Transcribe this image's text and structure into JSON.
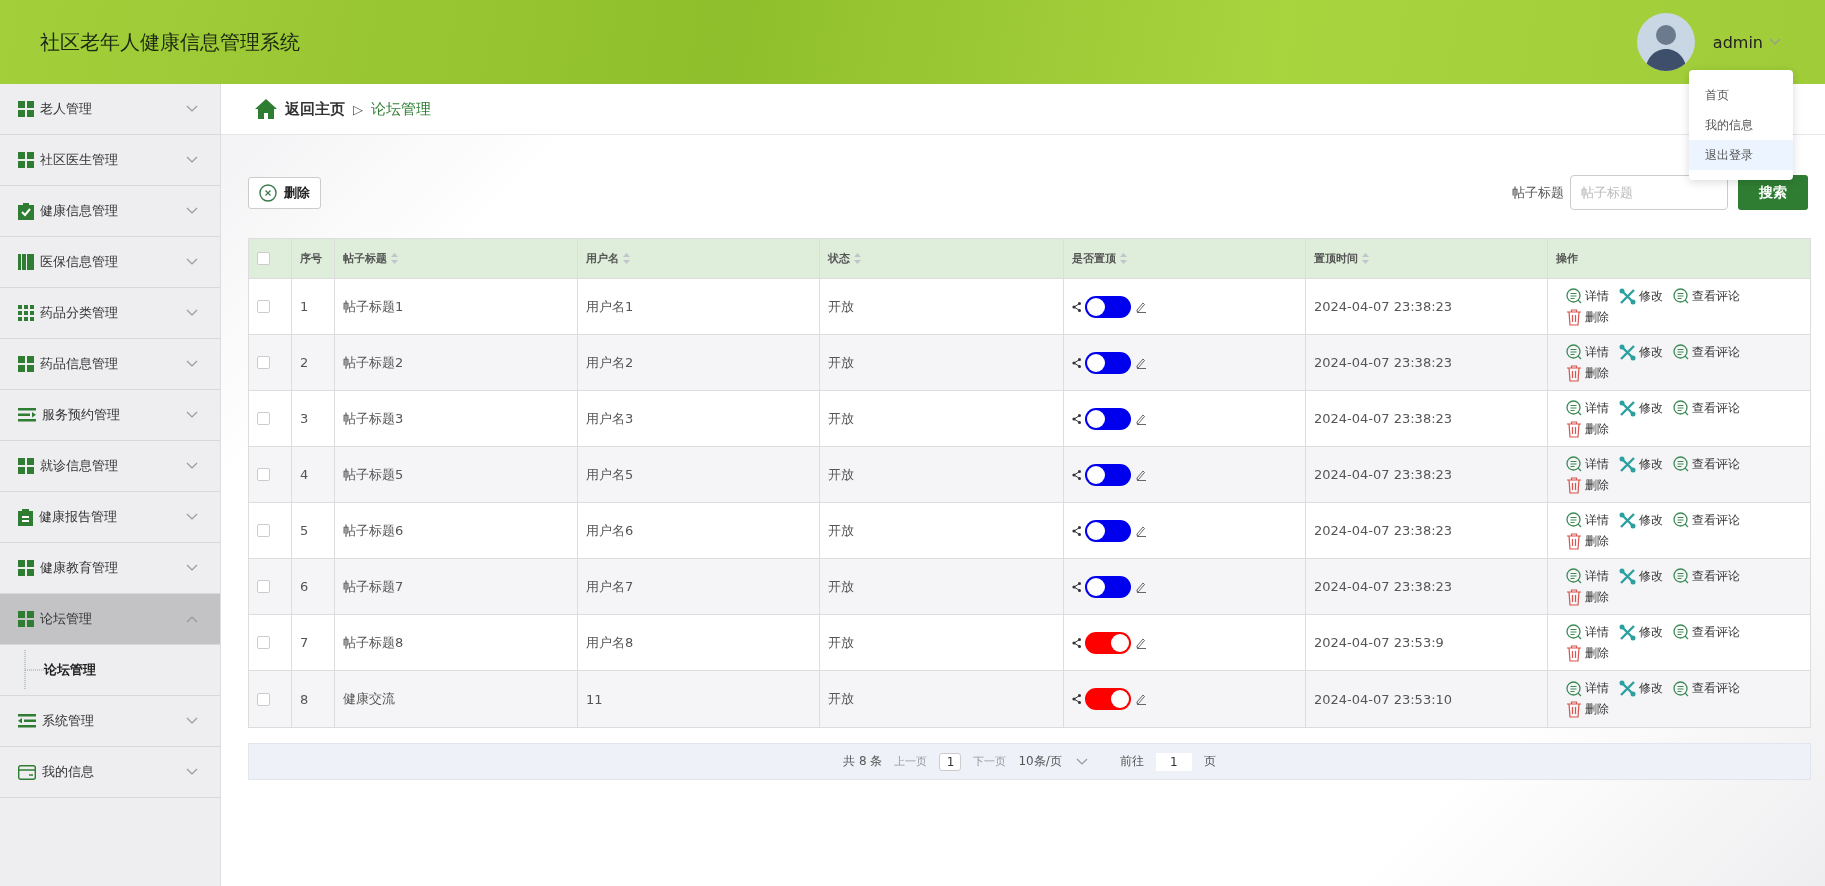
{
  "header": {
    "title": "社区老年人健康信息管理系统",
    "user": "admin",
    "user_menu": [
      {
        "label": "首页",
        "highlighted": false
      },
      {
        "label": "我的信息",
        "highlighted": false
      },
      {
        "label": "退出登录",
        "highlighted": true
      }
    ]
  },
  "sidebar": {
    "items": [
      {
        "label": "老人管理",
        "expanded": false,
        "selected": false
      },
      {
        "label": "社区医生管理",
        "expanded": false,
        "selected": false
      },
      {
        "label": "健康信息管理",
        "expanded": false,
        "selected": false
      },
      {
        "label": "医保信息管理",
        "expanded": false,
        "selected": false
      },
      {
        "label": "药品分类管理",
        "expanded": false,
        "selected": false
      },
      {
        "label": "药品信息管理",
        "expanded": false,
        "selected": false
      },
      {
        "label": "服务预约管理",
        "expanded": false,
        "selected": false
      },
      {
        "label": "就诊信息管理",
        "expanded": false,
        "selected": false
      },
      {
        "label": "健康报告管理",
        "expanded": false,
        "selected": false
      },
      {
        "label": "健康教育管理",
        "expanded": false,
        "selected": false
      },
      {
        "label": "论坛管理",
        "expanded": true,
        "selected": true,
        "children": [
          {
            "label": "论坛管理"
          }
        ]
      },
      {
        "label": "系统管理",
        "expanded": false,
        "selected": false
      },
      {
        "label": "我的信息",
        "expanded": false,
        "selected": false
      }
    ]
  },
  "breadcrumb": {
    "home": "返回主页",
    "separator": "▷",
    "current": "论坛管理"
  },
  "toolbar": {
    "delete_button": "删除",
    "search_label": "帖子标题",
    "search": {
      "placeholder": "帖子标题"
    },
    "search_button": "搜索"
  },
  "table": {
    "columns": [
      {
        "label": "序号",
        "sortable": false
      },
      {
        "label": "帖子标题",
        "sortable": true
      },
      {
        "label": "用户名",
        "sortable": true
      },
      {
        "label": "状态",
        "sortable": true
      },
      {
        "label": "是否置顶",
        "sortable": true
      },
      {
        "label": "置顶时间",
        "sortable": true
      },
      {
        "label": "操作",
        "sortable": false
      }
    ],
    "select_all_checked": false,
    "rows": [
      {
        "checked": false,
        "index": "1",
        "title": "帖子标题1",
        "user": "用户名1",
        "status": "开放",
        "pinned": false,
        "time": "2024-04-07 23:38:23",
        "actions": [
          "详情",
          "修改",
          "查看评论",
          "删除"
        ]
      },
      {
        "checked": false,
        "index": "2",
        "title": "帖子标题2",
        "user": "用户名2",
        "status": "开放",
        "pinned": false,
        "time": "2024-04-07 23:38:23",
        "actions": [
          "详情",
          "修改",
          "查看评论",
          "删除"
        ]
      },
      {
        "checked": false,
        "index": "3",
        "title": "帖子标题3",
        "user": "用户名3",
        "status": "开放",
        "pinned": false,
        "time": "2024-04-07 23:38:23",
        "actions": [
          "详情",
          "修改",
          "查看评论",
          "删除"
        ]
      },
      {
        "checked": false,
        "index": "4",
        "title": "帖子标题5",
        "user": "用户名5",
        "status": "开放",
        "pinned": false,
        "time": "2024-04-07 23:38:23",
        "actions": [
          "详情",
          "修改",
          "查看评论",
          "删除"
        ]
      },
      {
        "checked": false,
        "index": "5",
        "title": "帖子标题6",
        "user": "用户名6",
        "status": "开放",
        "pinned": false,
        "time": "2024-04-07 23:38:23",
        "actions": [
          "详情",
          "修改",
          "查看评论",
          "删除"
        ]
      },
      {
        "checked": false,
        "index": "6",
        "title": "帖子标题7",
        "user": "用户名7",
        "status": "开放",
        "pinned": false,
        "time": "2024-04-07 23:38:23",
        "actions": [
          "详情",
          "修改",
          "查看评论",
          "删除"
        ]
      },
      {
        "checked": false,
        "index": "7",
        "title": "帖子标题8",
        "user": "用户名8",
        "status": "开放",
        "pinned": true,
        "time": "2024-04-07 23:53:9",
        "actions": [
          "详情",
          "修改",
          "查看评论",
          "删除"
        ]
      },
      {
        "checked": false,
        "index": "8",
        "title": "健康交流",
        "user": "11",
        "status": "开放",
        "pinned": true,
        "time": "2024-04-07 23:53:10",
        "actions": [
          "详情",
          "修改",
          "查看评论",
          "删除"
        ]
      }
    ]
  },
  "pagination": {
    "total": "共 8 条",
    "prev": "上一页",
    "page": "1",
    "next": "下一页",
    "page_size": "10条/页",
    "goto_label": "前往",
    "goto_value": "1",
    "goto_suffix": "页"
  }
}
